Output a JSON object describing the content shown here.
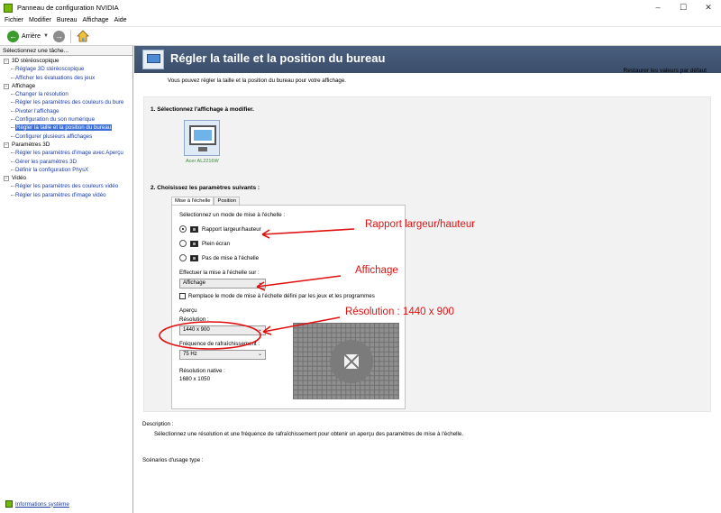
{
  "window": {
    "title": "Panneau de configuration NVIDIA",
    "controls": [
      "–",
      "☐",
      "✕"
    ]
  },
  "menu": [
    "Fichier",
    "Modifier",
    "Bureau",
    "Affichage",
    "Aide"
  ],
  "toolbar": {
    "back_label": "Arrière"
  },
  "sidebar": {
    "header": "Sélectionnez une tâche...",
    "groups": [
      {
        "label": "3D stéréoscopique",
        "items": [
          "Réglage 3D stéréoscopique",
          "Afficher les évaluations des jeux"
        ]
      },
      {
        "label": "Affichage",
        "items": [
          "Changer la résolution",
          "Régler les paramètres des couleurs du bure",
          "Pivoter l'affichage",
          "Configuration du son numérique",
          "Régler la taille et la position du bureau",
          "Configurer plusieurs affichages"
        ]
      },
      {
        "label": "Paramètres 3D",
        "items": [
          "Régler les paramètres d'image avec Aperçu",
          "Gérer les paramètres 3D",
          "Définir la configuration PhysX"
        ]
      },
      {
        "label": "Vidéo",
        "items": [
          "Régler les paramètres des couleurs vidéo",
          "Régler les paramètres d'image vidéo"
        ]
      }
    ],
    "system_info": "Informations système"
  },
  "main": {
    "title": "Régler la taille et la position du bureau",
    "restore_defaults": "Restaurer les valeurs par défaut",
    "intro": "Vous pouvez régler la taille et la position du bureau pour votre affichage.",
    "step1": "1. Sélectionnez l'affichage à modifier.",
    "display_name": "Acer AL2216W",
    "step2": "2. Choisissez les paramètres suivants :",
    "tabs": [
      "Mise à l'échelle",
      "Position"
    ],
    "scaling_mode_label": "Sélectionnez un mode de mise à l'échelle :",
    "modes": [
      "Rapport largeur/hauteur",
      "Plein écran",
      "Pas de mise à l'échelle"
    ],
    "perform_on_label": "Effectuer la mise à l'échelle sur :",
    "perform_on_value": "Affichage",
    "override_label": "Remplace le mode de mise à l'échelle défini par les jeux et les programmes",
    "preview_label": "Aperçu",
    "resolution_label": "Résolution :",
    "resolution_value": "1440 x 900",
    "refresh_label": "Fréquence de rafraîchissement :",
    "refresh_value": "75 Hz",
    "native_label": "Résolution native :",
    "native_value": "1680 x 1050",
    "description_title": "Description :",
    "description_text": "Sélectionnez une résolution et une fréquence de rafraîchissement pour obtenir un aperçu des paramètres de mise à l'échelle.",
    "usage_title": "Scénarios d'usage type :"
  },
  "annotations": {
    "ratio": "Rapport largeur/hauteur",
    "display": "Affichage",
    "resolution": "Résolution : 1440 x 900",
    "color": "#e01010"
  }
}
